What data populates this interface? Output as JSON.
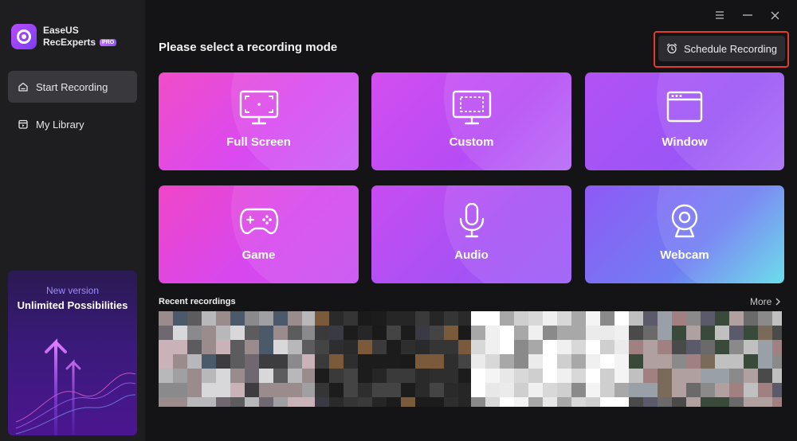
{
  "app": {
    "name_line1": "EaseUS",
    "name_line2": "RecExperts",
    "badge": "PRO"
  },
  "sidebar": {
    "items": [
      {
        "label": "Start Recording",
        "icon": "home-icon",
        "active": true
      },
      {
        "label": "My Library",
        "icon": "library-icon",
        "active": false
      }
    ],
    "promo": {
      "subtitle": "New version",
      "title": "Unlimited Possibilities"
    }
  },
  "window_controls": [
    "menu-icon",
    "minimize-icon",
    "close-icon"
  ],
  "main": {
    "heading": "Please select a recording mode",
    "schedule_label": "Schedule Recording",
    "modes": [
      {
        "label": "Full Screen",
        "icon": "monitor-fullscreen-icon"
      },
      {
        "label": "Custom",
        "icon": "monitor-custom-icon"
      },
      {
        "label": "Window",
        "icon": "window-icon"
      },
      {
        "label": "Game",
        "icon": "gamepad-icon"
      },
      {
        "label": "Audio",
        "icon": "microphone-icon"
      },
      {
        "label": "Webcam",
        "icon": "webcam-icon"
      }
    ],
    "recent_title": "Recent recordings",
    "more_label": "More"
  },
  "colors": {
    "accent_red": "#e23d2c",
    "sidebar_bg": "#1e1e21",
    "app_bg": "#141416",
    "promo_subtitle": "#9d8cff"
  }
}
